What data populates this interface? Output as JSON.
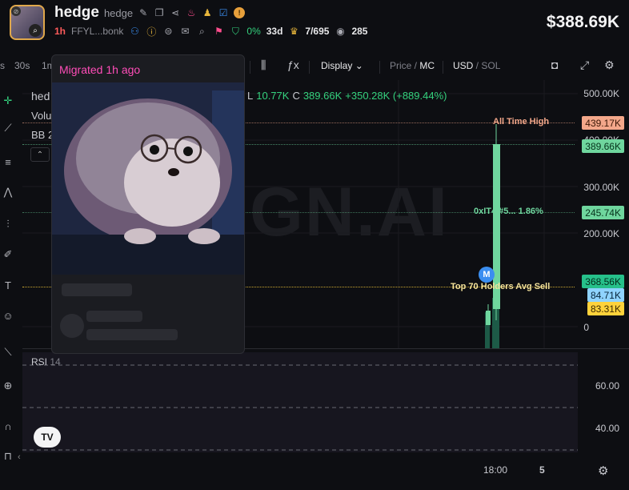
{
  "header": {
    "token_name": "hedge",
    "token_sub": "hedge",
    "age": "1h",
    "address": "FFYL...bonk",
    "holders_pct": "0%",
    "holders_age": "33d",
    "crown": "7/695",
    "views": "285",
    "price": "$388.69K",
    "badge_coin": "!"
  },
  "toolbar": {
    "timeframes": [
      "s",
      "30s",
      "1m"
    ],
    "display": "Display",
    "price_label": "Price",
    "mc_label": "MC",
    "usd_label": "USD",
    "sol_label": "SOL",
    "fx": "ƒx"
  },
  "chart": {
    "legend_name": "hed",
    "legend_vol": "Volu",
    "legend_bb": "BB",
    "legend_bb_val": "2",
    "ohlc": {
      "l_label": "L",
      "l_value": "10.77K",
      "c_label": "C",
      "c_value": "389.66K",
      "change": "+350.28K (+889.44%)"
    },
    "watermark": "GN.AI",
    "y_axis": [
      "500.00K",
      "400.00K",
      "300.00K",
      "200.00K",
      "0"
    ],
    "tags": {
      "ath": "439.17K",
      "last": "389.66K",
      "dev": "245.74K",
      "avg_sell": "368.56K",
      "blue": "84.71K",
      "yellow": "83.31K"
    },
    "annotations": {
      "ath": "All Time High",
      "dev": "0xIT4 #5... 1.86%",
      "avg_sell": "Top 70 Holders Avg Sell"
    },
    "marker": "M",
    "colors": {
      "up": "#6fd69e",
      "up_dark": "#1d5a47",
      "ath": "#f3a78a",
      "avg": "#ffd23b"
    }
  },
  "rsi": {
    "label": "RSI",
    "period": "14",
    "y_axis": [
      "60.00",
      "40.00"
    ]
  },
  "x_axis": [
    "18:00",
    "5"
  ],
  "popover": {
    "title": "Migrated 1h ago"
  }
}
